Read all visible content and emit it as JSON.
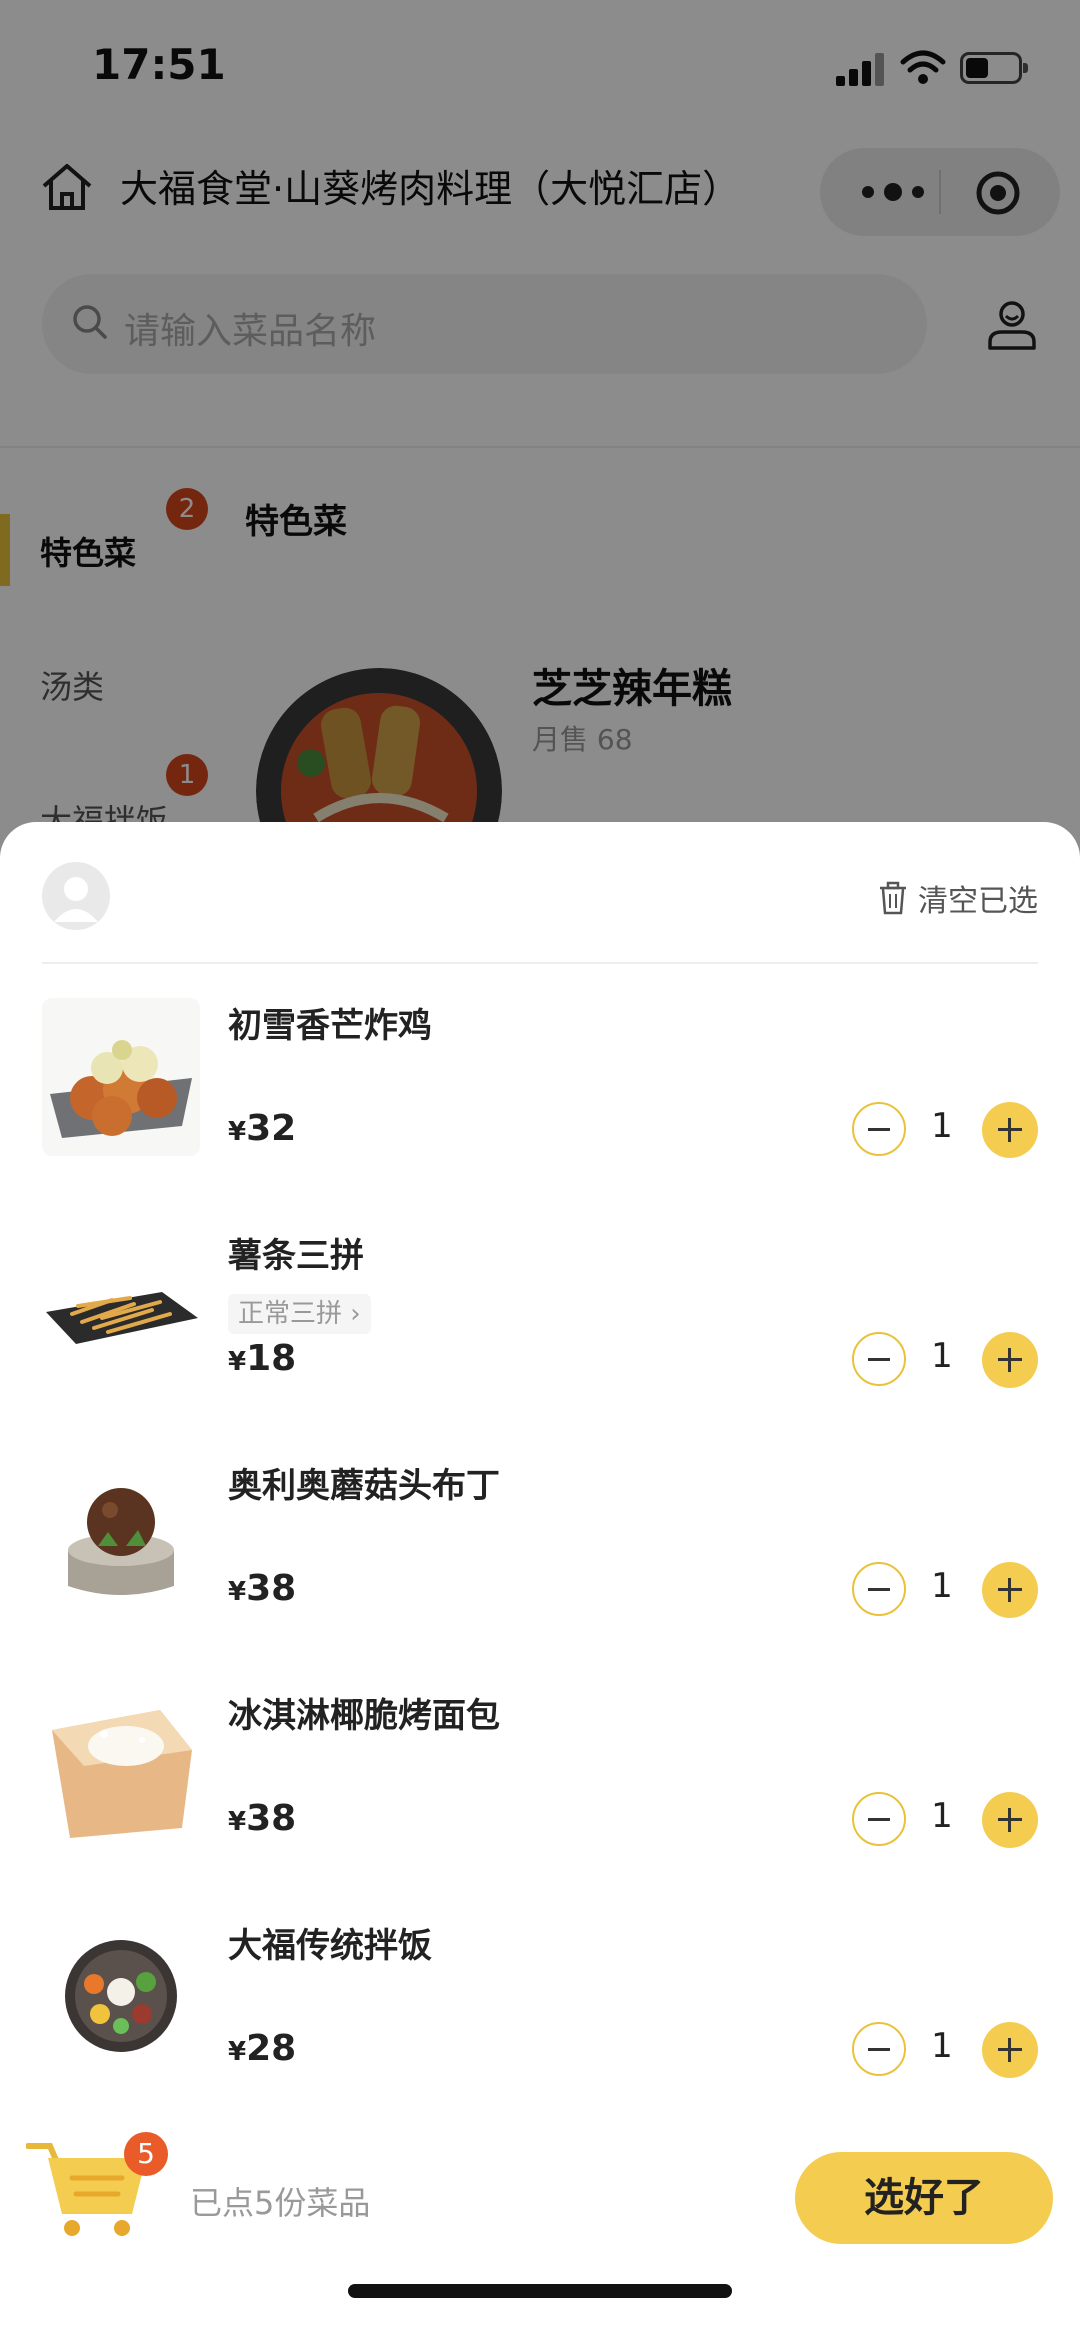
{
  "status_bar": {
    "time": "17:51"
  },
  "nav": {
    "store_title": "大福食堂·山葵烤肉料理（大悦汇店）"
  },
  "search": {
    "placeholder": "请输入菜品名称"
  },
  "sidebar": {
    "items": [
      {
        "label": "特色菜",
        "badge": "2"
      },
      {
        "label": "汤类"
      },
      {
        "label": "大福拌饭",
        "badge": "1"
      }
    ]
  },
  "menu": {
    "section_title": "特色菜",
    "dish": {
      "name": "芝芝辣年糕",
      "sales": "月售 68"
    }
  },
  "cart": {
    "clear_label": "清空已选",
    "items": [
      {
        "name": "初雪香芒炸鸡",
        "spec": "",
        "currency": "¥",
        "price": "32",
        "qty": "1"
      },
      {
        "name": "薯条三拼",
        "spec": "正常三拼 ›",
        "currency": "¥",
        "price": "18",
        "qty": "1"
      },
      {
        "name": "奥利奥蘑菇头布丁",
        "spec": "",
        "currency": "¥",
        "price": "38",
        "qty": "1"
      },
      {
        "name": "冰淇淋椰脆烤面包",
        "spec": "",
        "currency": "¥",
        "price": "38",
        "qty": "1"
      },
      {
        "name": "大福传统拌饭",
        "spec": "",
        "currency": "¥",
        "price": "28",
        "qty": "1"
      }
    ],
    "badge_count": "5",
    "summary": "已点5份菜品",
    "confirm_label": "选好了"
  },
  "colors": {
    "accent": "#f4cc4f",
    "badge": "#ea5b2a",
    "sidebar_badge": "#d6451c"
  }
}
